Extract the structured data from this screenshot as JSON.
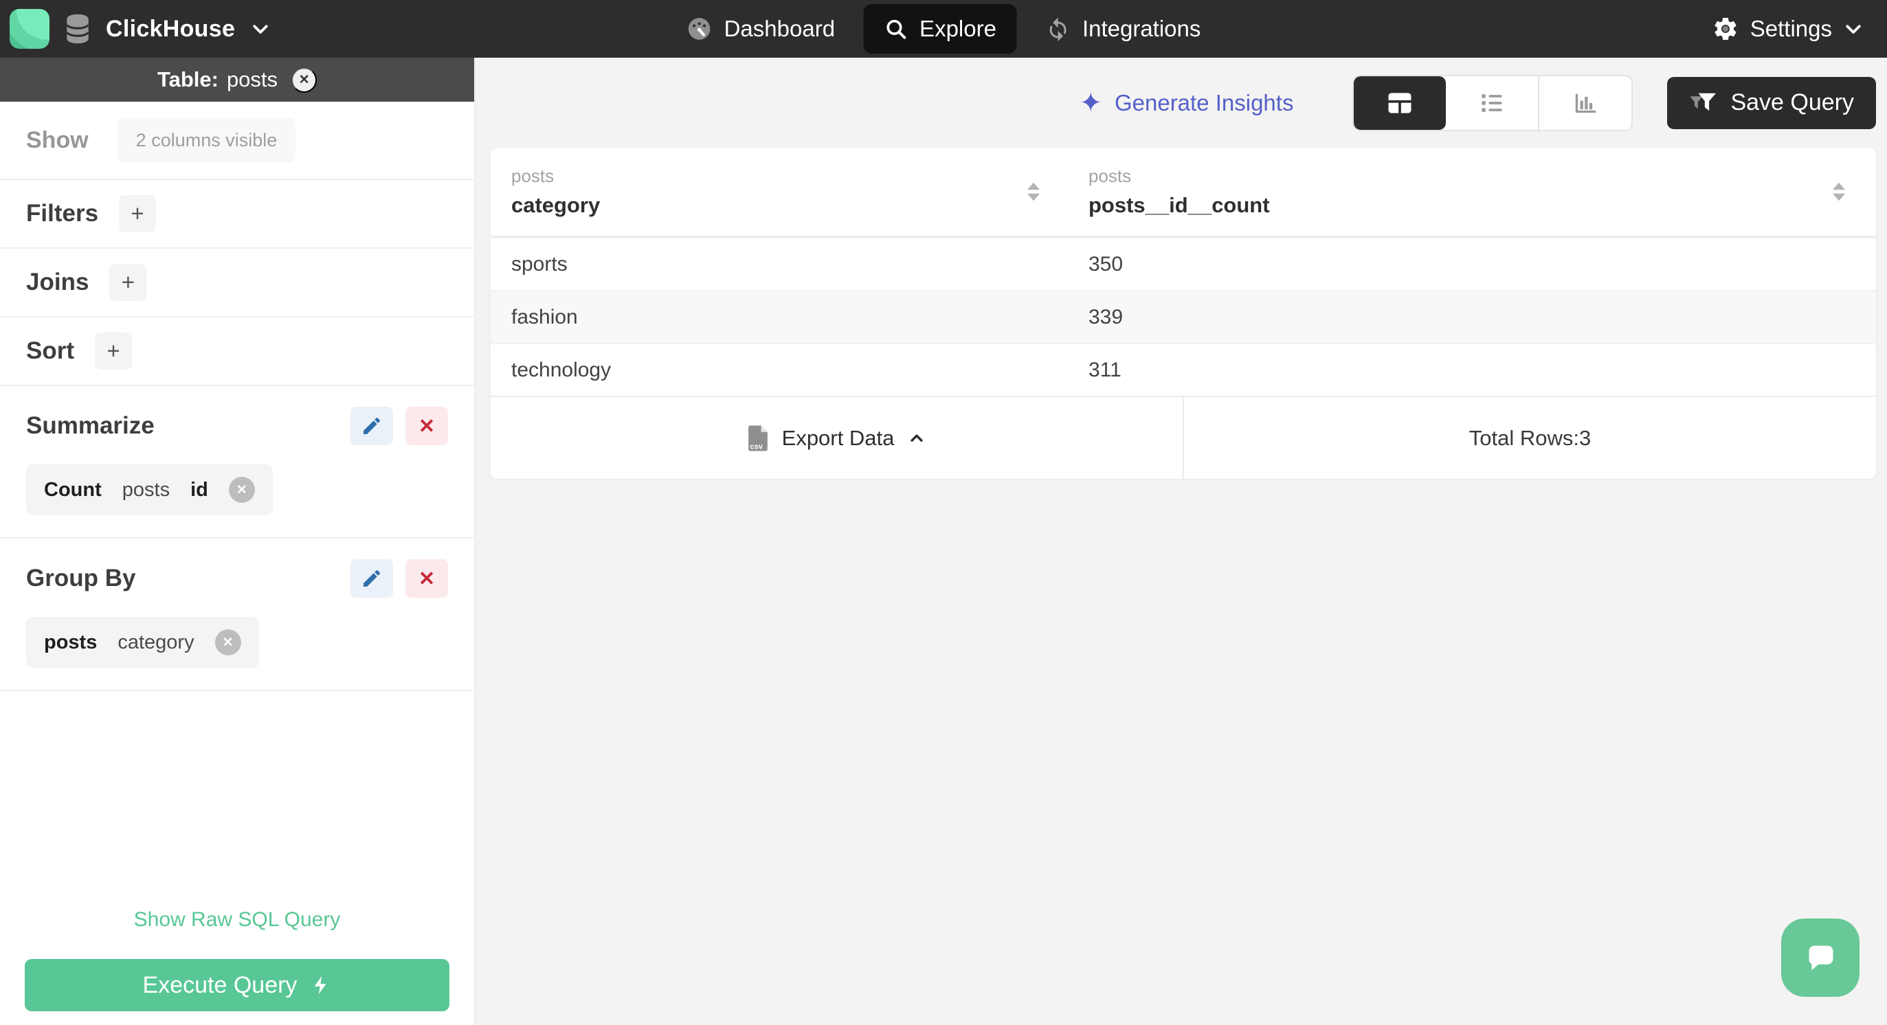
{
  "navbar": {
    "brand": "ClickHouse",
    "items": [
      {
        "label": "Dashboard"
      },
      {
        "label": "Explore",
        "active": true
      },
      {
        "label": "Integrations"
      }
    ],
    "settings_label": "Settings"
  },
  "sidebar": {
    "table_label": "Table:",
    "table_name": "posts",
    "show_label": "Show",
    "columns_badge": "2 columns visible",
    "sections": [
      {
        "label": "Filters"
      },
      {
        "label": "Joins"
      },
      {
        "label": "Sort"
      }
    ],
    "summarize": {
      "label": "Summarize",
      "chip": {
        "agg": "Count",
        "table": "posts",
        "column": "id"
      }
    },
    "group_by": {
      "label": "Group By",
      "chip": {
        "table": "posts",
        "column": "category"
      }
    },
    "raw_sql_link": "Show Raw SQL Query",
    "execute_label": "Execute Query"
  },
  "main": {
    "insights_label": "Generate Insights",
    "save_label": "Save Query",
    "table": {
      "columns": [
        {
          "group": "posts",
          "name": "category"
        },
        {
          "group": "posts",
          "name": "posts__id__count"
        }
      ],
      "rows": [
        [
          "sports",
          "350"
        ],
        [
          "fashion",
          "339"
        ],
        [
          "technology",
          "311"
        ]
      ],
      "export_label": "Export Data",
      "total_label": "Total Rows:3"
    }
  },
  "icons": {
    "close": "✕",
    "plus": "+",
    "sparkle": "✦",
    "x": "✕",
    "csv_label": "csv"
  },
  "colors": {
    "brand_green": "#58C795",
    "accent_indigo": "#5560C9",
    "edit_blue": "#2F6FAD",
    "danger_red": "#C6293A",
    "navbar_dark": "#2D2D2D",
    "sidebar_header_gray": "#4B4B4B",
    "row_alt": "#F8F8F8"
  }
}
